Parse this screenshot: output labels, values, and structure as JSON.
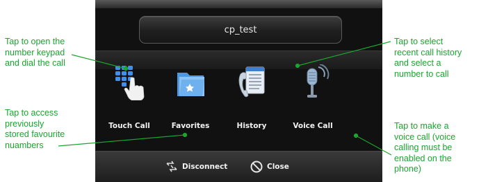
{
  "screen": {
    "title": "cp_test",
    "buttons": [
      {
        "id": "touch-call",
        "label": "Touch Call",
        "icon": "keypad-hand-icon"
      },
      {
        "id": "favorites",
        "label": "Favorites",
        "icon": "star-folder-icon"
      },
      {
        "id": "history",
        "label": "History",
        "icon": "call-history-icon"
      },
      {
        "id": "voice-call",
        "label": "Voice Call",
        "icon": "microphone-icon"
      }
    ],
    "bottom_bar": {
      "disconnect_label": "Disconnect",
      "close_label": "Close"
    }
  },
  "annotations": {
    "touch_call": "Tap to open the\nnumber keypad\nand dial the call",
    "favorites": "Tap to access\npreviously\nstored favourite\nnuambers",
    "history": "Tap to select\nrecent call history\nand select a\nnumber to call",
    "voice_call": "Tap to make a\nvoice call (voice\ncalling must be\nenabled on the\nphone)"
  },
  "colors": {
    "annotation_green": "#1aa52f",
    "screen_background": "#111111",
    "label_text": "#f2f2f2"
  }
}
